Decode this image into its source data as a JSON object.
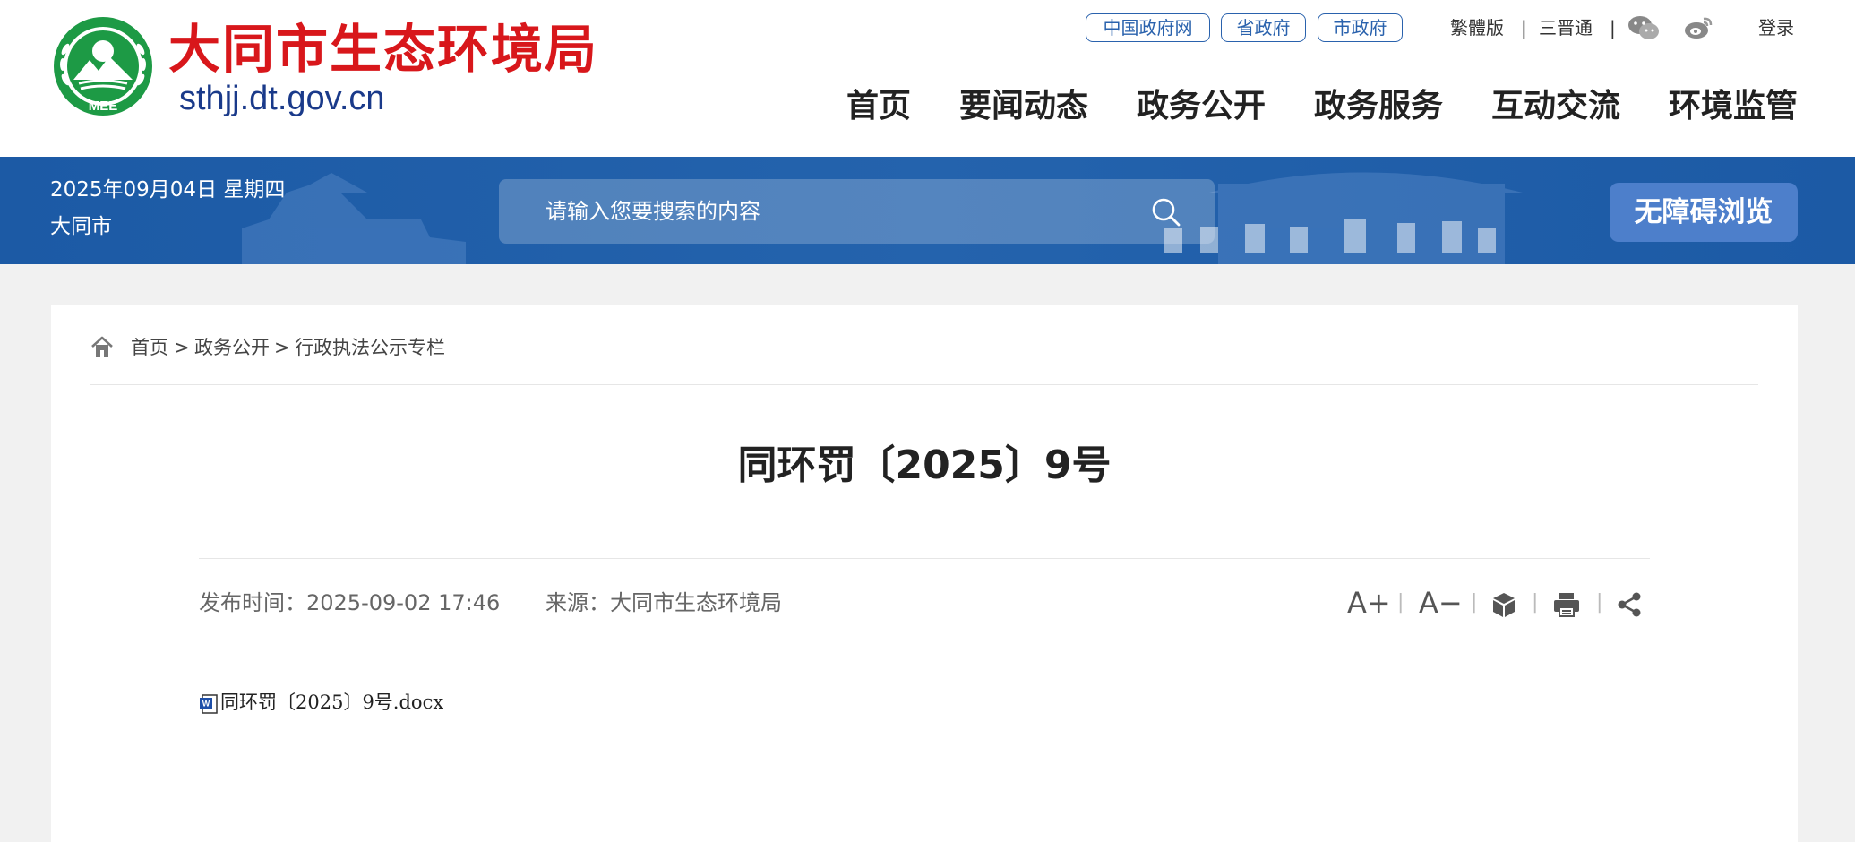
{
  "site": {
    "title": "大同市生态环境局",
    "domain": "sthjj.dt.gov.cn",
    "emblem_text": "MEE"
  },
  "gov_links": [
    "中国政府网",
    "省政府",
    "市政府"
  ],
  "top_links": {
    "traditional": "繁體版",
    "sanjin": "三晋通",
    "login": "登录",
    "separator": "|"
  },
  "icons": {
    "wechat": "wechat-icon",
    "weibo": "weibo-icon",
    "search": "search-icon",
    "home": "home-icon"
  },
  "nav": [
    "首页",
    "要闻动态",
    "政务公开",
    "政务服务",
    "互动交流",
    "环境监管"
  ],
  "banner": {
    "date": "2025年09月04日 星期四",
    "city": "大同市",
    "search_placeholder": "请输入您要搜索的内容",
    "accessibility": "无障碍浏览"
  },
  "breadcrumb": [
    "首页",
    "政务公开",
    "行政执法公示专栏"
  ],
  "breadcrumb_sep": ">",
  "article": {
    "title": "同环罚〔2025〕9号",
    "published": "发布时间：2025-09-02 17:46",
    "source": "来源：大同市生态环境局",
    "attachment": "同环罚〔2025〕9号.docx"
  },
  "tools": {
    "font_up": "A+",
    "font_down": "A−",
    "sep": "|"
  },
  "colors": {
    "brand_red": "#d8171b",
    "brand_blue": "#2060aa",
    "link_blue": "#2a62ad",
    "emblem_green": "#1d9a45"
  }
}
